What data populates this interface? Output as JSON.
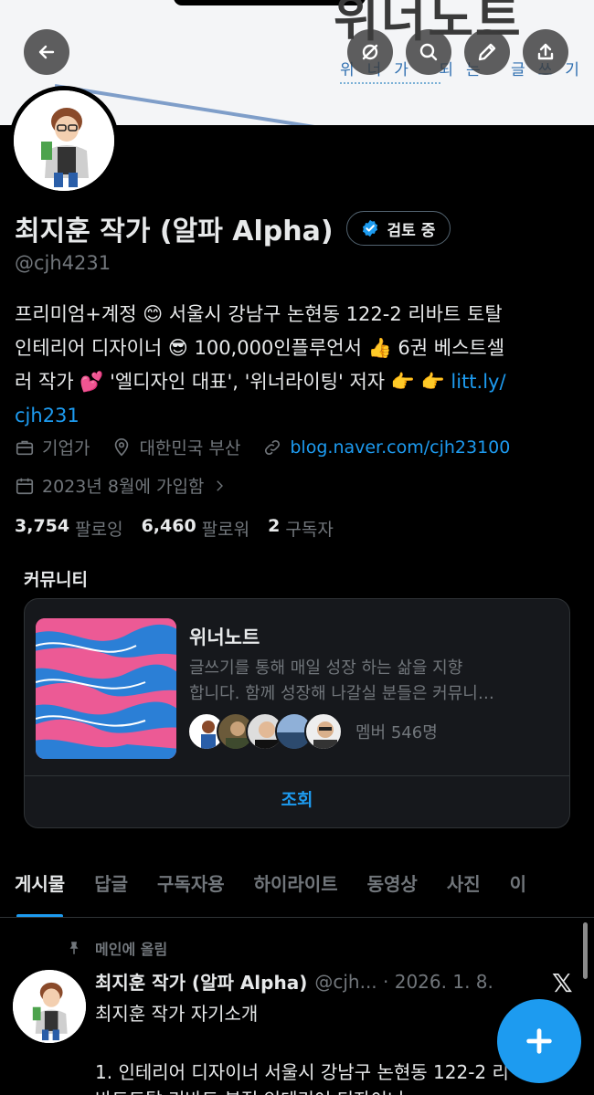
{
  "banner": {
    "title": "위너노트",
    "subtitle": "위너가 되는 글쓰기"
  },
  "profile": {
    "name": "최지훈 작가 (알파 Alpha)",
    "verify_label": "검토 중",
    "handle": "@cjh4231",
    "bio_line1": "프리미엄+계정 😊 서울시 강남구 논현동 122-2 리바트 토탈",
    "bio_line2": "인테리어 디자이너 😎 100,000인플루언서 👍 6권 베스트셀",
    "bio_line3": "러 작가 💕 '엘디자인 대표', '위너라이팅' 저자 👉 👉 ",
    "bio_link_a": "litt.ly/",
    "bio_link_b": "cjh231",
    "category": "기업가",
    "location": "대한민국 부산",
    "website": "blog.naver.com/cjh23100",
    "joined": "2023년 8월에 가입함",
    "following_count": "3,754",
    "following_label": "팔로잉",
    "followers_count": "6,460",
    "followers_label": "팔로워",
    "subscribers_count": "2",
    "subscribers_label": "구독자"
  },
  "community": {
    "section_title": "커뮤니티",
    "name": "위너노트",
    "desc_line1": "글쓰기를 통해 매일 성장 하는 삶을 지향",
    "desc_line2": "합니다. 함께 성장해 나갈실 분들은 커뮤니…",
    "members_label": "멤버 546명",
    "view_button": "조회"
  },
  "tabs": [
    "게시물",
    "답글",
    "구독자용",
    "하이라이트",
    "동영상",
    "사진",
    "이"
  ],
  "post": {
    "pinned_label": "메인에 올림",
    "author_name": "최지훈 작가 (알파 Alpha)",
    "author_meta": "@cjh... · 2026. 1. 8.",
    "x_logo": "𝕏",
    "line1": "최지훈 작가 자기소개",
    "line2": "1. 인테리어 디자이너 서울시 강남구 논현동 122-2 리",
    "line3": "바트토탈 리바트 분점 인테리어 디자이너"
  },
  "colors": {
    "background": "#000000",
    "accent": "#1d9bf0",
    "muted": "#71767b",
    "text": "#e7e9ea"
  }
}
